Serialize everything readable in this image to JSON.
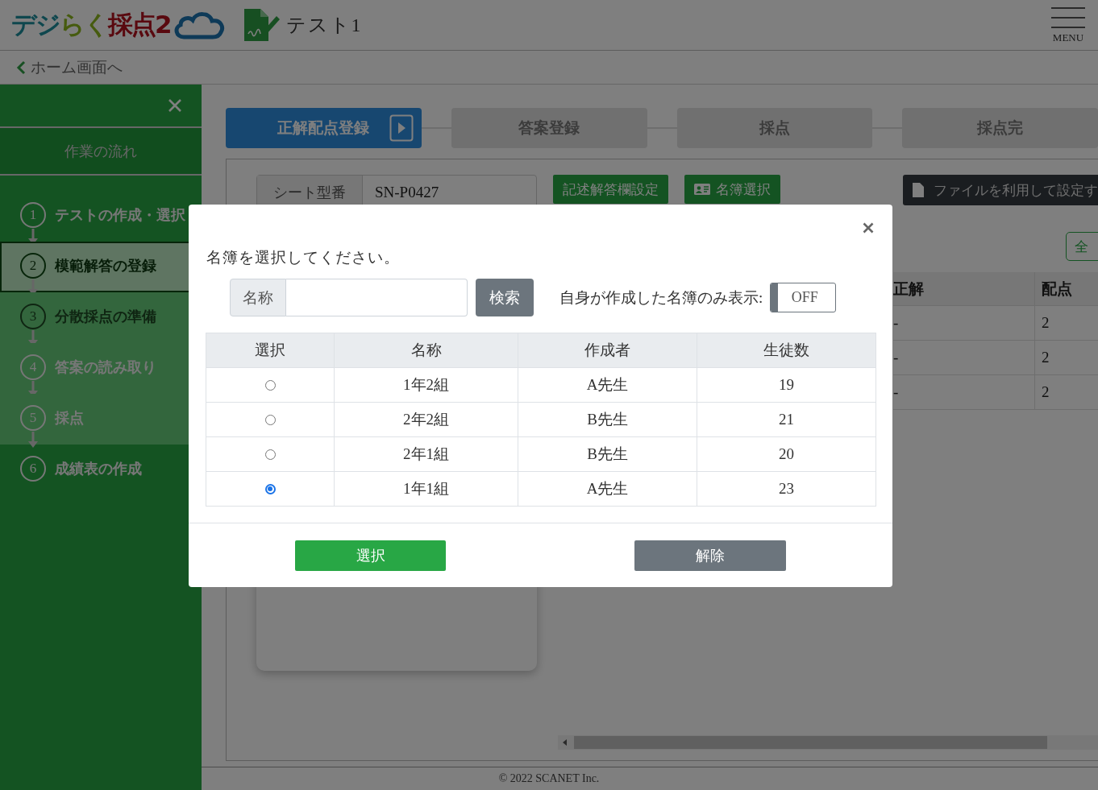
{
  "header": {
    "logo": [
      "デジ",
      "らく",
      "採点2"
    ],
    "title": "テスト1",
    "menu_label": "MENU"
  },
  "breadcrumb": {
    "back_link": "ホーム画面へ"
  },
  "sidebar": {
    "heading": "作業の流れ",
    "steps": [
      {
        "number": "1",
        "label": "テストの作成・選択",
        "selected": false,
        "disabled": false,
        "upcoming": false
      },
      {
        "number": "2",
        "label": "模範解答の登録",
        "selected": true,
        "disabled": false,
        "upcoming": false
      },
      {
        "number": "3",
        "label": "分散採点の準備",
        "selected": false,
        "disabled": true,
        "upcoming": true
      },
      {
        "number": "4",
        "label": "答案の読み取り",
        "selected": false,
        "disabled": false,
        "upcoming": true
      },
      {
        "number": "5",
        "label": "採点",
        "selected": false,
        "disabled": false,
        "upcoming": true
      },
      {
        "number": "6",
        "label": "成績表の作成",
        "selected": false,
        "disabled": false,
        "upcoming": false
      }
    ]
  },
  "steps_bar": [
    {
      "label": "正解配点登録",
      "selected": true
    },
    {
      "label": "答案登録",
      "selected": false
    },
    {
      "label": "採点",
      "selected": false
    },
    {
      "label": "採点完",
      "selected": false
    }
  ],
  "toolbar": {
    "sheet_label": "シート型番",
    "sheet_value": "SN-P0427",
    "buttons": [
      "記述解答欄設定",
      "名簿選択"
    ],
    "file_button": "ファイルを利用して設定す"
  },
  "answer_table": {
    "button": "全",
    "columns": [
      "正解",
      "配点"
    ],
    "rows": [
      [
        "-",
        "2"
      ],
      [
        "-",
        "2"
      ],
      [
        "-",
        "2"
      ]
    ]
  },
  "dialog": {
    "prompt": "名簿を選択してください。",
    "search": {
      "label": "名称",
      "button": "検索"
    },
    "filter_label": "自身が作成した名簿のみ表示:",
    "filter_toggle": {
      "label": "OFF",
      "on": false
    },
    "table": {
      "columns": [
        "選択",
        "名称",
        "作成者",
        "生徒数"
      ],
      "rows": [
        {
          "name": "1年2組",
          "author": "A先生",
          "students": "19",
          "selected": false
        },
        {
          "name": "2年2組",
          "author": "B先生",
          "students": "21",
          "selected": false
        },
        {
          "name": "2年1組",
          "author": "B先生",
          "students": "20",
          "selected": false
        },
        {
          "name": "1年1組",
          "author": "A先生",
          "students": "23",
          "selected": true
        }
      ]
    },
    "buttons": [
      "選択",
      "解除"
    ]
  },
  "footer": "© 2022 SCANET Inc."
}
